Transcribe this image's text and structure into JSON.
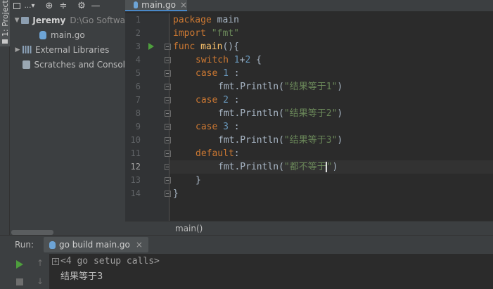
{
  "tool_strip": {
    "project_tab": "1: Project"
  },
  "project_panel": {
    "tree": {
      "root_name": "Jeremy",
      "root_path": "D:\\Go Softwa",
      "file": "main.go",
      "external_libraries": "External Libraries",
      "scratches": "Scratches and Consol"
    }
  },
  "editor": {
    "tab": {
      "label": "main.go",
      "close": "×"
    },
    "line_numbers": [
      "1",
      "2",
      "3",
      "4",
      "5",
      "6",
      "7",
      "8",
      "9",
      "10",
      "11",
      "12",
      "13",
      "14"
    ],
    "current_line": "12",
    "code": {
      "l1_kw": "package",
      "l1_rest": " main",
      "l2_kw": "import",
      "l2_str": "\"fmt\"",
      "l3_kw": "func",
      "l3_fn": "main",
      "l3_rest": "(){",
      "l4_kw": "switch",
      "l4_n1": "1",
      "l4_op": "+",
      "l4_n2": "2",
      "l4_rest": " {",
      "l5_kw": "case",
      "l5_num": "1",
      "l5_rest": " :",
      "l6_call": "fmt.Println(",
      "l6_str": "\"结果等于1\"",
      "l6_end": ")",
      "l7_kw": "case",
      "l7_num": "2",
      "l7_rest": " :",
      "l8_call": "fmt.Println(",
      "l8_str": "\"结果等于2\"",
      "l8_end": ")",
      "l9_kw": "case",
      "l9_num": "3",
      "l9_rest": " :",
      "l10_call": "fmt.Println(",
      "l10_str": "\"结果等于3\"",
      "l10_end": ")",
      "l11_kw": "default",
      "l11_rest": ":",
      "l12_call": "fmt.Println(",
      "l12_str_a": "\"都不等于",
      "l12_str_b": "\"",
      "l12_end": ")",
      "l13": "}",
      "l14": "}"
    },
    "breadcrumb": "main()"
  },
  "run_panel": {
    "label": "Run:",
    "tab_label": "go build main.go",
    "tab_close": "×",
    "console": {
      "setup_calls": "<4 go setup calls>",
      "output": "结果等于3"
    }
  },
  "colors": {
    "keyword": "#cc7832",
    "number": "#6897bb",
    "string": "#6a8759",
    "function": "#ffc66d",
    "run_green": "#4e9f3d"
  }
}
